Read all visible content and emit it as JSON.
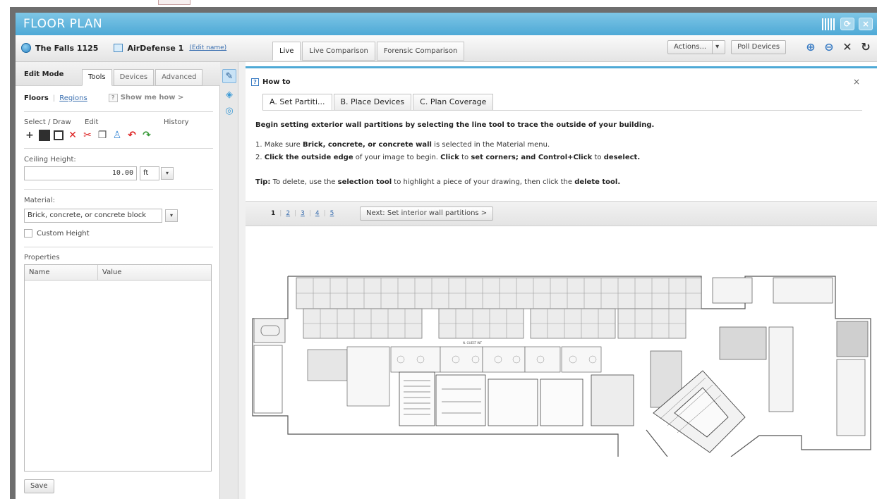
{
  "window": {
    "title": "FLOOR PLAN"
  },
  "toolbar": {
    "site_name": "The Falls 1125",
    "floor_name": "AirDefense 1",
    "edit_name_link": "(Edit name)",
    "tabs": [
      "Live",
      "Live Comparison",
      "Forensic Comparison"
    ],
    "actions_label": "Actions...",
    "poll_label": "Poll Devices"
  },
  "left": {
    "mode_label": "Edit Mode",
    "tabs": [
      "Tools",
      "Devices",
      "Advanced"
    ],
    "floors_label": "Floors",
    "regions_label": "Regions",
    "show_me_label": "Show me how >",
    "group_labels": {
      "select": "Select / Draw",
      "edit": "Edit",
      "history": "History"
    },
    "ceiling_label": "Ceiling Height:",
    "ceiling_value": "10.00",
    "ceiling_unit": "ft",
    "material_label": "Material:",
    "material_value": "Brick, concrete, or concrete block",
    "custom_height_label": "Custom Height",
    "properties_label": "Properties",
    "properties_columns": [
      "Name",
      "Value"
    ],
    "save_label": "Save"
  },
  "howto": {
    "title": "How to",
    "tabs": [
      "A. Set Partiti...",
      "B. Place Devices",
      "C. Plan Coverage"
    ],
    "heading": "Begin setting exterior wall partitions by selecting the line tool to trace the outside of your building.",
    "step1_pre": "1. Make sure ",
    "step1_bold": "Brick, concrete, or concrete wall",
    "step1_post": " is selected in the Material menu.",
    "step2_a": "2. ",
    "step2_b": "Click the outside edge",
    "step2_c": " of your image to begin. ",
    "step2_d": "Click",
    "step2_e": " to ",
    "step2_f": "set corners; and Control+Click",
    "step2_g": " to ",
    "step2_h": "deselect.",
    "tip_label": "Tip:",
    "tip_a": " To delete, use the ",
    "tip_b": "selection tool",
    "tip_c": " to highlight a piece of your drawing, then click the ",
    "tip_d": "delete tool.",
    "pages": [
      "1",
      "2",
      "3",
      "4",
      "5"
    ],
    "next_label": "Next: Set interior wall partitions >"
  },
  "plan": {
    "label": "N. GUEST INT"
  }
}
